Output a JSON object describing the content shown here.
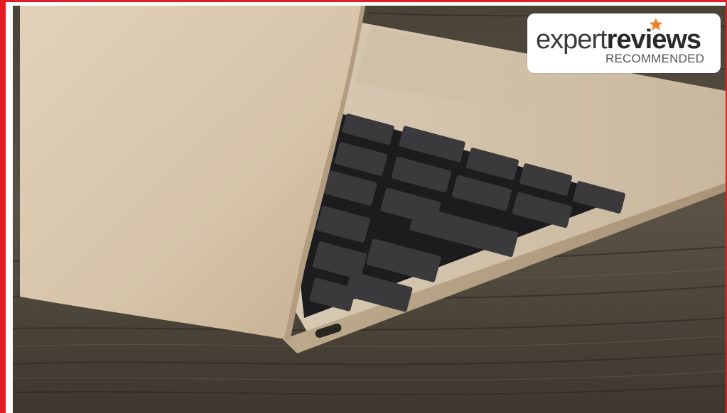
{
  "badge": {
    "brand_light": "expert",
    "brand_bold": "reviews",
    "subtitle": "RECOMMENDED",
    "star_color": "#f47b20"
  },
  "frame": {
    "accent_color": "#e51b23"
  },
  "photo": {
    "subject": "laptop-keyboard-photo"
  }
}
